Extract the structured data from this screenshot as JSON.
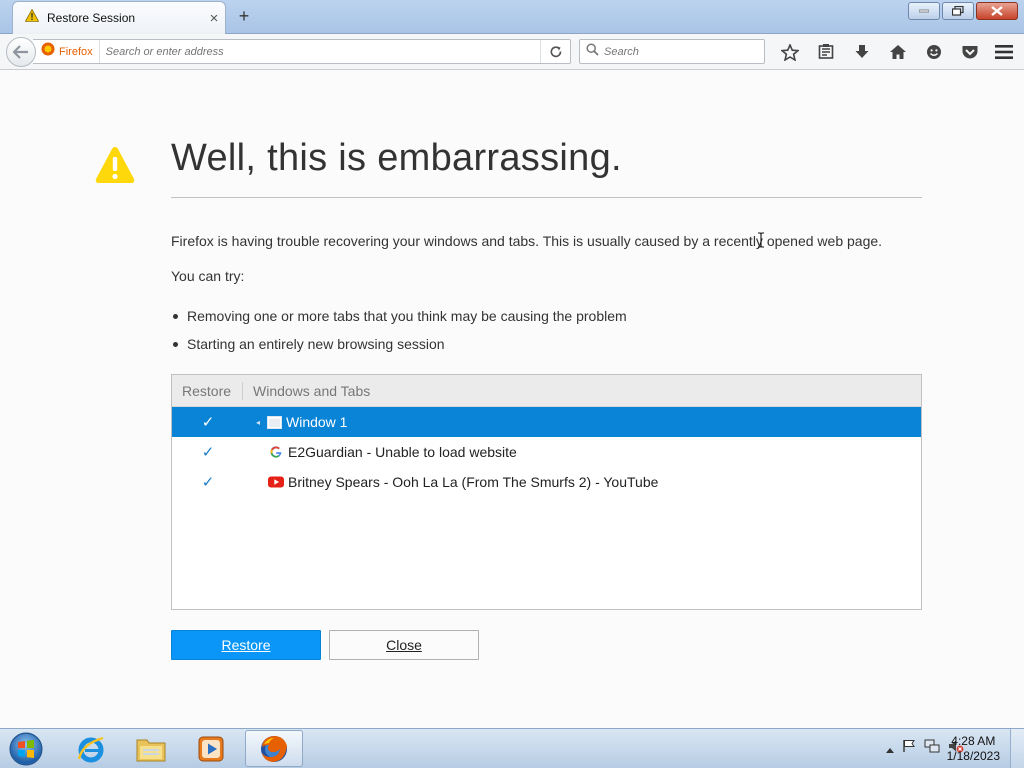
{
  "browser": {
    "tab_title": "Restore Session",
    "tab_close_glyph": "×",
    "new_tab_glyph": "+",
    "identity_label": "Firefox",
    "url_placeholder": "Search or enter address",
    "search_placeholder": "Search",
    "nav_icons": [
      "bookmark-star-icon",
      "reading-list-icon",
      "download-icon",
      "home-icon",
      "hello-icon",
      "pocket-icon"
    ]
  },
  "page": {
    "title": "Well, this is embarrassing.",
    "message": "Firefox is having trouble recovering your windows and tabs. This is usually caused by a recently opened web page.",
    "try_label": "You can try:",
    "suggestions": [
      "Removing one or more tabs that you think may be causing the problem",
      "Starting an entirely new browsing session"
    ],
    "tree": {
      "col_restore": "Restore",
      "col_windows": "Windows and Tabs",
      "window_label": "Window 1",
      "check_glyph": "✓",
      "tabs": [
        {
          "title": "E2Guardian - Unable to load website",
          "favicon": "google-icon"
        },
        {
          "title": "Britney Spears - Ooh La La (From The Smurfs 2) - YouTube",
          "favicon": "youtube-icon"
        }
      ]
    },
    "buttons": {
      "restore": "Restore",
      "close": "Close"
    }
  },
  "taskbar": {
    "time": "4:28 AM",
    "date": "1/18/2023",
    "items": [
      "internet-explorer-icon",
      "file-explorer-icon",
      "media-player-icon",
      "firefox-icon"
    ]
  },
  "colors": {
    "selection": "#0a84d6",
    "primary_button": "#0996f8",
    "warning": "#ffd80b"
  }
}
